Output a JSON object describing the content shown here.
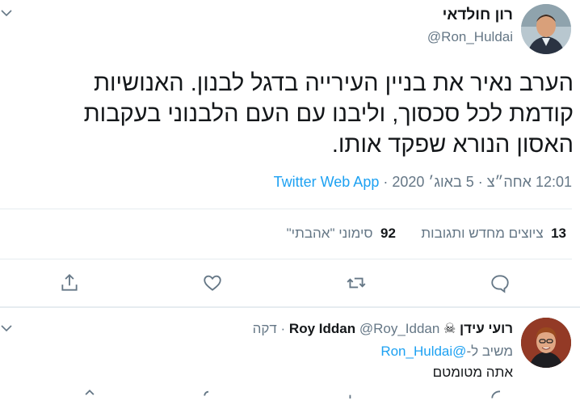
{
  "tweet": {
    "author_name": "רון חולדאי",
    "author_handle": "@Ron_Huldai",
    "text_line1": "הערב נאיר את בניין העירייה בדגל לבנון. האנושיות",
    "text_line2": "קודמת לכל סכסוך, וליבנו עם העם הלבנוני בעקבות",
    "text_line3": "האסון הנורא שפקד אותו.",
    "timestamp": "12:01 אחה״צ · 5 באוג׳ 2020",
    "separator": "·",
    "source_app": "Twitter Web App",
    "retweets_count": "13",
    "retweets_label": "ציוצים מחדש ותגובות",
    "likes_count": "92",
    "likes_label": "סימוני \"אהבתי\""
  },
  "reply": {
    "author_name_he": "רועי עידן",
    "author_name_en": "Roy Iddan",
    "badge": "☠",
    "author_handle": "@Roy_Iddan",
    "time": "· דקה",
    "replying_to_label": "משיב ל-",
    "replying_to_handle": "@Ron_Huldai",
    "text": "אתה מטומטם"
  },
  "icons": {
    "caret": "chevron-down-icon",
    "reply": "reply-icon",
    "retweet": "retweet-icon",
    "like": "heart-icon",
    "share": "share-icon"
  },
  "colors": {
    "accent": "#1da1f2",
    "secondary_text": "#657786",
    "divider": "#e6ecf0"
  }
}
